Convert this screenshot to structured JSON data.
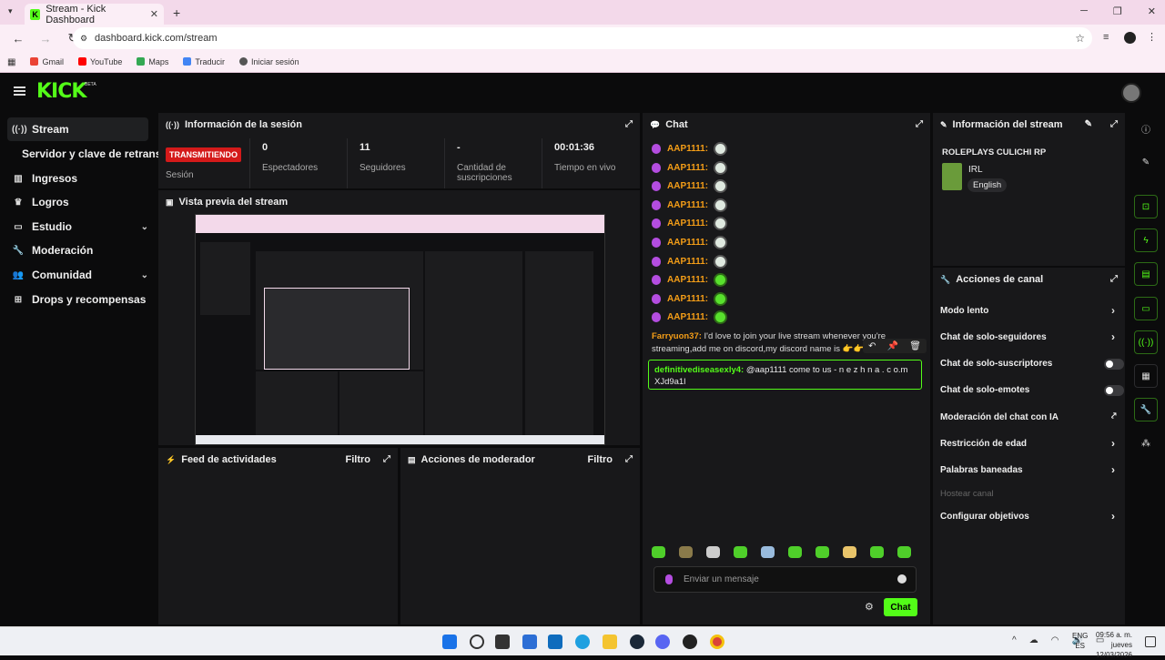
{
  "browser": {
    "tab_title": "Stream - Kick Dashboard",
    "url": "dashboard.kick.com/stream",
    "bookmarks": [
      {
        "label": "Gmail",
        "color": "#ea4335"
      },
      {
        "label": "YouTube",
        "color": "#ff0000"
      },
      {
        "label": "Maps",
        "color": "#34a853"
      },
      {
        "label": "Traducir",
        "color": "#4285f4"
      },
      {
        "label": "Iniciar sesión",
        "color": "#555555"
      }
    ]
  },
  "app": {
    "logo": "KICK",
    "logo_badge": "BETA",
    "accent": "#53fc18"
  },
  "sidebar": {
    "items": [
      {
        "label": "Stream",
        "icon": "stream-icon"
      },
      {
        "label": "Servidor y clave de retransm",
        "icon": ""
      },
      {
        "label": "Ingresos",
        "icon": "chart-icon"
      },
      {
        "label": "Logros",
        "icon": "trophy-icon"
      },
      {
        "label": "Estudio",
        "icon": "studio-icon"
      },
      {
        "label": "Moderación",
        "icon": "wrench-icon"
      },
      {
        "label": "Comunidad",
        "icon": "people-icon"
      },
      {
        "label": "Drops y recompensas",
        "icon": "drops-icon"
      }
    ]
  },
  "session": {
    "title": "Información de la sesión",
    "live_badge": "TRANSMITIENDO",
    "stats": [
      {
        "label": "Sesión",
        "value": ""
      },
      {
        "label": "Espectadores",
        "value": "0"
      },
      {
        "label": "Seguidores",
        "value": "11"
      },
      {
        "label": "Cantidad de suscripciones",
        "value": "-"
      },
      {
        "label": "Tiempo en vivo",
        "value": "00:01:36"
      }
    ]
  },
  "preview": {
    "title": "Vista previa del stream"
  },
  "feed": {
    "title": "Feed de actividades",
    "filter": "Filtro"
  },
  "modactions": {
    "title": "Acciones de moderador",
    "filter": "Filtro"
  },
  "chat": {
    "title": "Chat",
    "lines": [
      {
        "user": "AAP1111:",
        "emote": "skull"
      },
      {
        "user": "AAP1111:",
        "emote": "skull"
      },
      {
        "user": "AAP1111:",
        "emote": "skull"
      },
      {
        "user": "AAP1111:",
        "emote": "skull"
      },
      {
        "user": "AAP1111:",
        "emote": "skull"
      },
      {
        "user": "AAP1111:",
        "emote": "skull"
      },
      {
        "user": "AAP1111:",
        "emote": "skull"
      },
      {
        "user": "AAP1111:",
        "emote": "green"
      },
      {
        "user": "AAP1111:",
        "emote": "green"
      },
      {
        "user": "AAP1111:",
        "emote": "green"
      }
    ],
    "msg1_user": "Farryuon37:",
    "msg1_text": " I'd love to join your live stream whenever you're streaming,add me on discord,my discord name is 👉👉 j",
    "msg2_user": "definitivediseasexly4:",
    "msg2_text": " @aap1111 come to us - n e z h n a . c o.m XJd9a1l",
    "input_placeholder": "Enviar un mensaje",
    "send_label": "Chat"
  },
  "stream_info": {
    "title": "Información del stream",
    "stream_name": "ROLEPLAYS CULICHI RP",
    "category": "IRL",
    "language": "English"
  },
  "channel_actions": {
    "title": "Acciones de canal",
    "items": [
      {
        "label": "Modo lento",
        "control": "arrow"
      },
      {
        "label": "Chat de solo-seguidores",
        "control": "arrow"
      },
      {
        "label": "Chat de solo-suscriptores",
        "control": "toggle"
      },
      {
        "label": "Chat de solo-emotes",
        "control": "toggle"
      },
      {
        "label": "Moderación del chat con IA",
        "control": "external"
      },
      {
        "label": "Restricción de edad",
        "control": "arrow"
      },
      {
        "label": "Palabras baneadas",
        "control": "arrow"
      },
      {
        "label": "Hostear canal",
        "control": "none"
      },
      {
        "label": "Configurar objetivos",
        "control": "arrow"
      }
    ]
  },
  "taskbar": {
    "lang": "ENG",
    "lang2": "ES",
    "time": "09:56 a. m.",
    "day": "jueves",
    "date": "12/03/2026"
  }
}
